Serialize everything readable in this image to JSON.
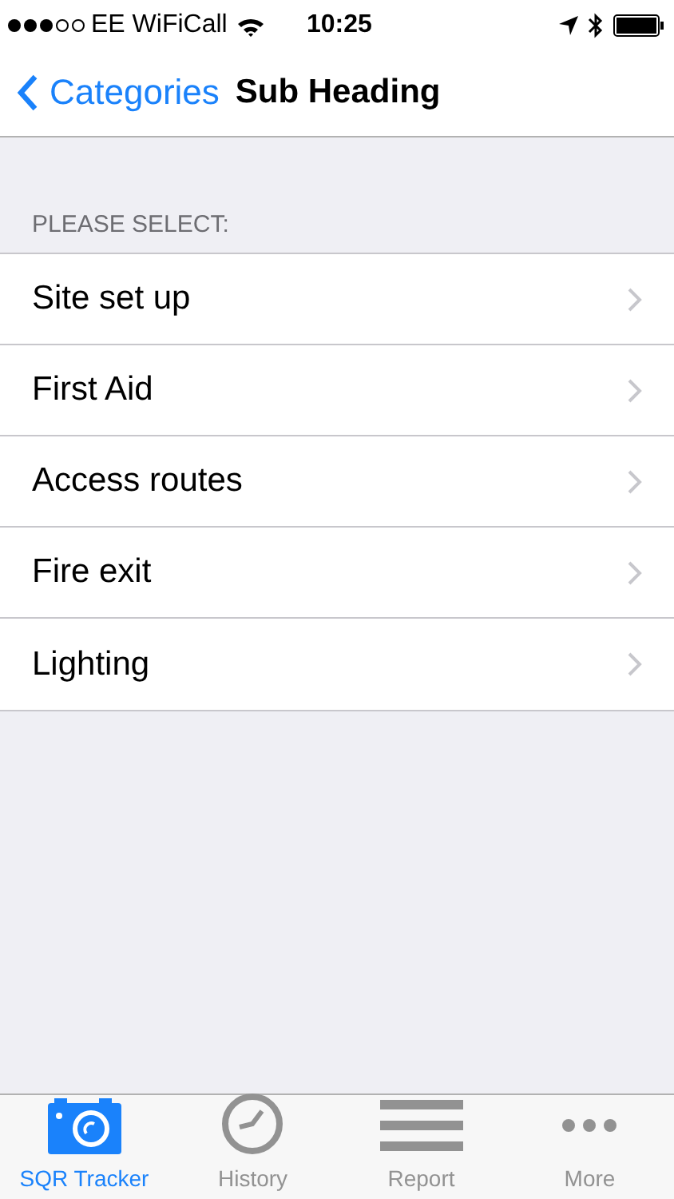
{
  "status_bar": {
    "carrier": "EE WiFiCall",
    "time": "10:25"
  },
  "nav": {
    "back": "Categories",
    "title": "Sub Heading"
  },
  "section_header": "PLEASE SELECT:",
  "items": [
    {
      "label": "Site set up"
    },
    {
      "label": "First Aid"
    },
    {
      "label": "Access routes"
    },
    {
      "label": "Fire exit"
    },
    {
      "label": "Lighting"
    }
  ],
  "tabs": [
    {
      "label": "SQR Tracker",
      "selected": true
    },
    {
      "label": "History",
      "selected": false
    },
    {
      "label": "Report",
      "selected": false
    },
    {
      "label": "More",
      "selected": false
    }
  ]
}
